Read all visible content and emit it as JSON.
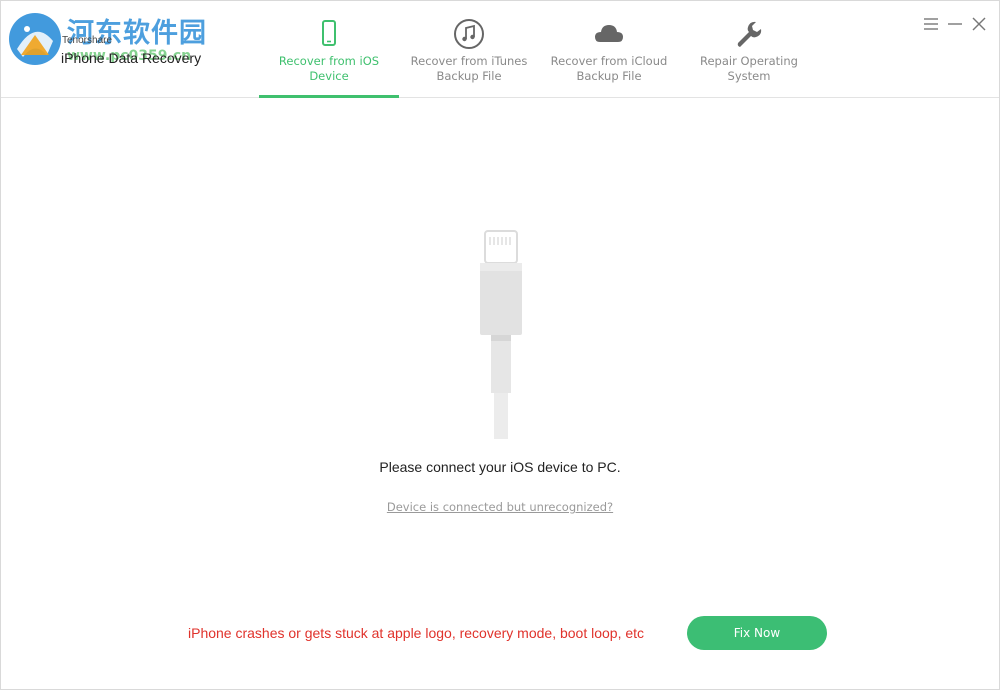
{
  "app": {
    "brand": "Tenorshare",
    "product": "iPhone Data Recovery",
    "watermark": "河东软件园",
    "watermark_url": "www.pc0359.cn"
  },
  "tabs": [
    {
      "label": "Recover from iOS Device",
      "icon": "phone-icon",
      "active": true
    },
    {
      "label": "Recover from iTunes Backup File",
      "icon": "music-note-icon",
      "active": false
    },
    {
      "label": "Recover from iCloud Backup File",
      "icon": "cloud-icon",
      "active": false
    },
    {
      "label": "Repair Operating System",
      "icon": "wrench-icon",
      "active": false
    }
  ],
  "window_controls": [
    "menu-icon",
    "minimize-icon",
    "close-icon"
  ],
  "main": {
    "prompt": "Please connect your iOS device to PC.",
    "help_link": "Device is connected but unrecognized?"
  },
  "footer": {
    "message": "iPhone crashes or gets stuck at apple logo, recovery mode, boot loop, etc",
    "button_label": "Fix Now"
  },
  "colors": {
    "accent": "#3fc06e",
    "button": "#3cbe74",
    "warning": "#e0322b",
    "tab_inactive": "#8a8a8a"
  }
}
